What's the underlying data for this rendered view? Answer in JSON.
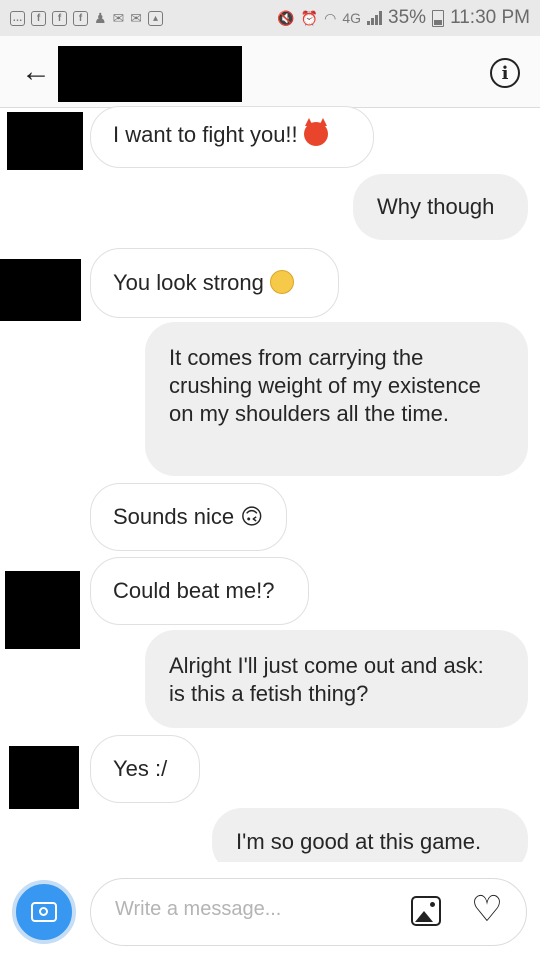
{
  "status_bar": {
    "network": "4G",
    "battery": "35%",
    "time": "11:30 PM"
  },
  "header": {
    "back_icon": "arrow-left-icon",
    "info_icon": "info-icon"
  },
  "messages": [
    {
      "direction": "incoming",
      "text": "I want to fight you!!",
      "emoji": "angry-devil-emoji"
    },
    {
      "direction": "outgoing",
      "text": "Why though"
    },
    {
      "direction": "incoming",
      "text": "You look strong",
      "emoji": "flushed-face-emoji"
    },
    {
      "direction": "outgoing",
      "text": "It comes from carrying the crushing weight of my existence on my shoulders all the time."
    },
    {
      "direction": "incoming",
      "text": "Sounds nice 🙃"
    },
    {
      "direction": "incoming",
      "text": "Could beat me!?"
    },
    {
      "direction": "outgoing",
      "text": "Alright I'll just come out and ask: is this a fetish thing?"
    },
    {
      "direction": "incoming",
      "text": "Yes :/"
    },
    {
      "direction": "outgoing",
      "text": "I'm so good at this game."
    }
  ],
  "composer": {
    "placeholder": "Write a message...",
    "value": "",
    "camera_icon": "camera-icon",
    "gallery_icon": "gallery-icon",
    "like_icon": "heart-icon"
  },
  "colors": {
    "camera_button": "#3897f0",
    "outgoing_bubble": "#efefef",
    "incoming_border": "#e0e0e0"
  }
}
